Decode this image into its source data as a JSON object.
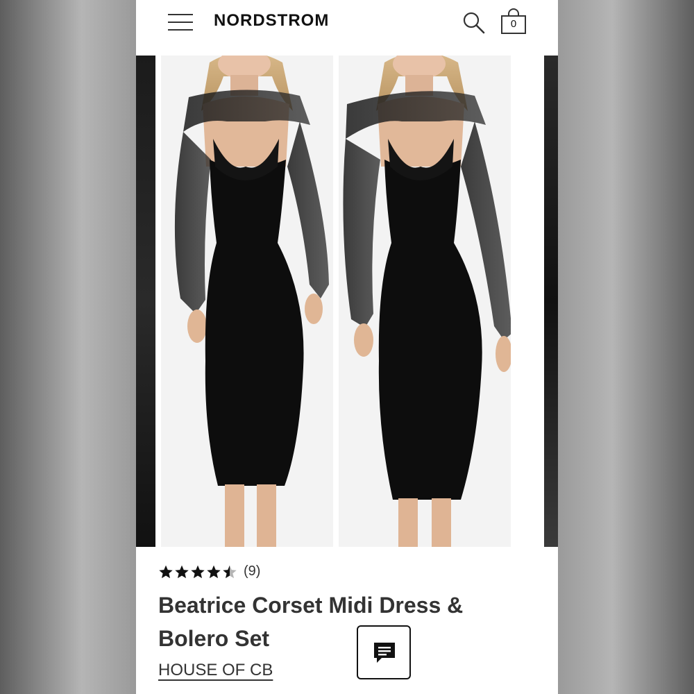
{
  "header": {
    "brand": "NORDSTROM",
    "menu_icon": "hamburger-menu-icon",
    "search_icon": "search-icon",
    "bag_icon": "shopping-bag-icon",
    "bag_count": "0"
  },
  "gallery": {
    "images": [
      {
        "alt": "Model wearing black corset midi dress with sheer bolero, front view"
      },
      {
        "alt": "Model wearing black corset midi dress with sheer bolero, front view alternate"
      }
    ]
  },
  "product": {
    "rating": 4.5,
    "rating_max": 5,
    "review_count": "(9)",
    "title": "Beatrice Corset Midi Dress & Bolero Set",
    "brand": "HOUSE OF CB"
  },
  "chat": {
    "icon": "chat-icon"
  },
  "colors": {
    "text": "#333333",
    "accent": "#111111"
  }
}
